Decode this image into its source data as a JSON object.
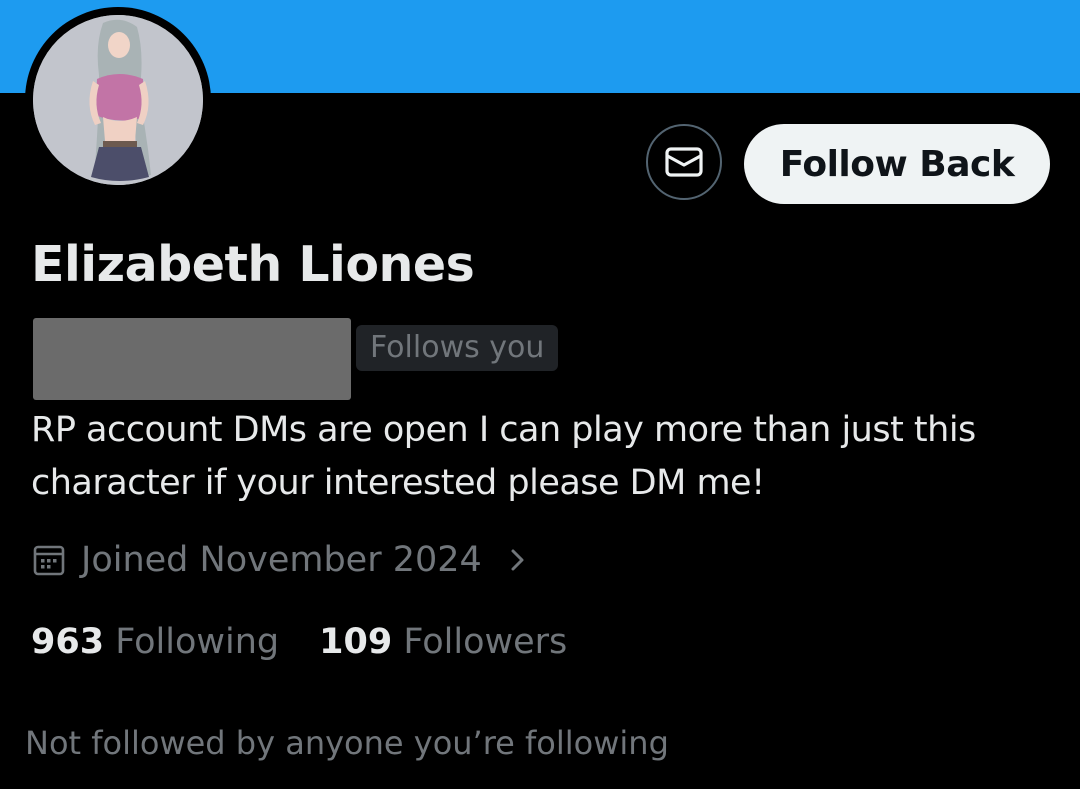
{
  "colors": {
    "banner": "#1d9bf0",
    "background": "#000000",
    "primary_text": "#e7e9ea",
    "secondary_text": "#71767b",
    "follow_button_bg": "#eff3f4"
  },
  "header": {
    "message_icon": "mail-icon",
    "follow_label": "Follow Back"
  },
  "profile": {
    "display_name": "Elizabeth Liones",
    "follows_you": "Follows you",
    "bio": "RP account DMs are open I can play more than just this character if your interested please DM me!",
    "joined_icon": "calendar-icon",
    "joined": "Joined November 2024"
  },
  "stats": {
    "following_count": "963",
    "following_label": "Following",
    "followers_count": "109",
    "followers_label": "Followers"
  },
  "footer": {
    "not_followed": "Not followed by anyone you’re following"
  }
}
